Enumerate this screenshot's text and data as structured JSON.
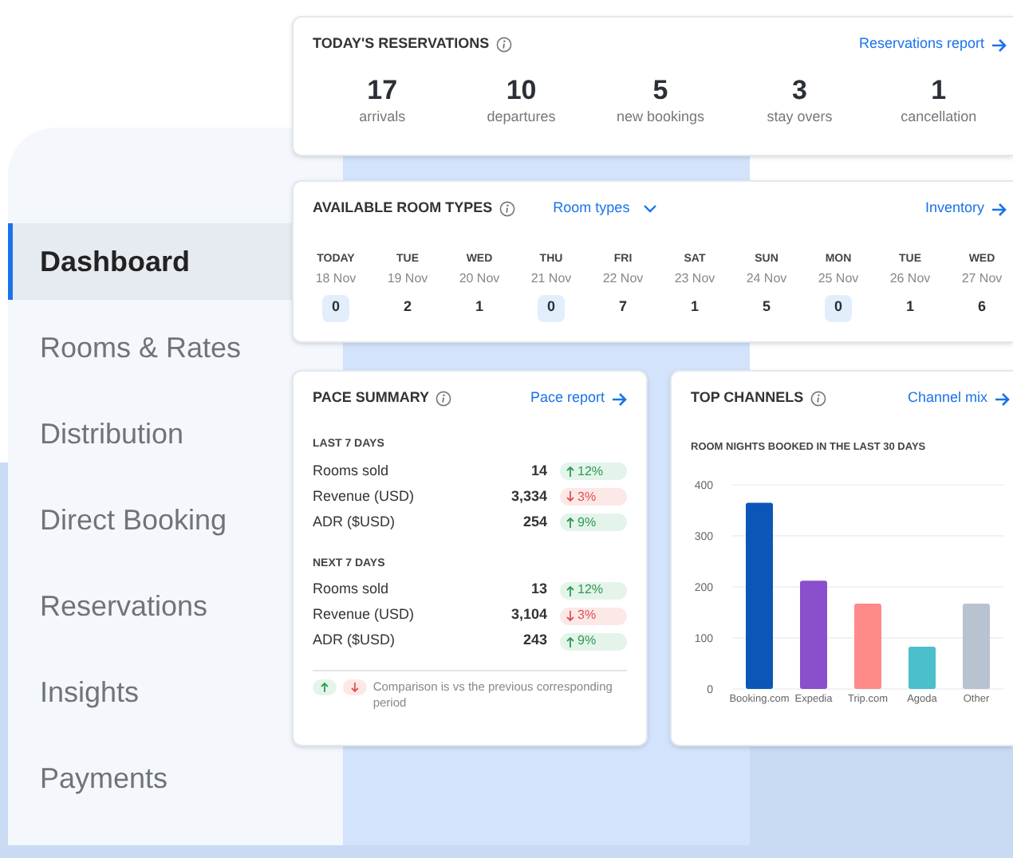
{
  "sidebar": {
    "items": [
      {
        "label": "Dashboard",
        "selected": true
      },
      {
        "label": "Rooms & Rates",
        "selected": false
      },
      {
        "label": "Distribution",
        "selected": false
      },
      {
        "label": "Direct Booking",
        "selected": false
      },
      {
        "label": "Reservations",
        "selected": false
      },
      {
        "label": "Insights",
        "selected": false
      },
      {
        "label": "Payments",
        "selected": false
      }
    ]
  },
  "todays_reservations": {
    "title": "TODAY'S RESERVATIONS",
    "link": "Reservations report",
    "stats": [
      {
        "value": "17",
        "label": "arrivals"
      },
      {
        "value": "10",
        "label": "departures"
      },
      {
        "value": "5",
        "label": "new bookings"
      },
      {
        "value": "3",
        "label": "stay overs"
      },
      {
        "value": "1",
        "label": "cancellation"
      }
    ]
  },
  "available_room_types": {
    "title": "AVAILABLE ROOM TYPES",
    "filter": "Room types",
    "link": "Inventory",
    "days": [
      {
        "day": "TODAY",
        "date": "18 Nov",
        "count": "0",
        "highlighted": true
      },
      {
        "day": "TUE",
        "date": "19 Nov",
        "count": "2",
        "highlighted": false
      },
      {
        "day": "WED",
        "date": "20 Nov",
        "count": "1",
        "highlighted": false
      },
      {
        "day": "THU",
        "date": "21 Nov",
        "count": "0",
        "highlighted": true
      },
      {
        "day": "FRI",
        "date": "22 Nov",
        "count": "7",
        "highlighted": false
      },
      {
        "day": "SAT",
        "date": "23 Nov",
        "count": "1",
        "highlighted": false
      },
      {
        "day": "SUN",
        "date": "24 Nov",
        "count": "5",
        "highlighted": false
      },
      {
        "day": "MON",
        "date": "25 Nov",
        "count": "0",
        "highlighted": true
      },
      {
        "day": "TUE",
        "date": "26 Nov",
        "count": "1",
        "highlighted": false
      },
      {
        "day": "WED",
        "date": "27 Nov",
        "count": "6",
        "highlighted": false
      }
    ]
  },
  "pace_summary": {
    "title": "PACE SUMMARY",
    "link": "Pace report",
    "sections": [
      {
        "heading": "LAST 7 DAYS",
        "rows": [
          {
            "label": "Rooms sold",
            "value": "14",
            "change": "12%",
            "kind": "up"
          },
          {
            "label": "Revenue (USD)",
            "value": "3,334",
            "change": "3%",
            "kind": "down"
          },
          {
            "label": "ADR ($USD)",
            "value": "254",
            "change": "9%",
            "kind": "up"
          }
        ]
      },
      {
        "heading": "NEXT 7 DAYS",
        "rows": [
          {
            "label": "Rooms sold",
            "value": "13",
            "change": "12%",
            "kind": "up"
          },
          {
            "label": "Revenue (USD)",
            "value": "3,104",
            "change": "3%",
            "kind": "down"
          },
          {
            "label": "ADR ($USD)",
            "value": "243",
            "change": "9%",
            "kind": "up"
          }
        ]
      }
    ],
    "footnote": "Comparison is vs the previous corresponding period"
  },
  "top_channels": {
    "title": "TOP CHANNELS",
    "link": "Channel mix",
    "chart_data": {
      "type": "bar",
      "title": "ROOM NIGHTS BOOKED IN THE LAST 30 DAYS",
      "categories": [
        "Booking.com",
        "Expedia",
        "Trip.com",
        "Agoda",
        "Other"
      ],
      "values": [
        365,
        212,
        167,
        83,
        167
      ],
      "colors": [
        "#0b57b8",
        "#8a4fcc",
        "#ff8a8a",
        "#4bbfcc",
        "#b8c2d1"
      ],
      "ylim": [
        0,
        400
      ],
      "yticks": [
        0,
        100,
        200,
        300,
        400
      ],
      "grid": true
    }
  }
}
